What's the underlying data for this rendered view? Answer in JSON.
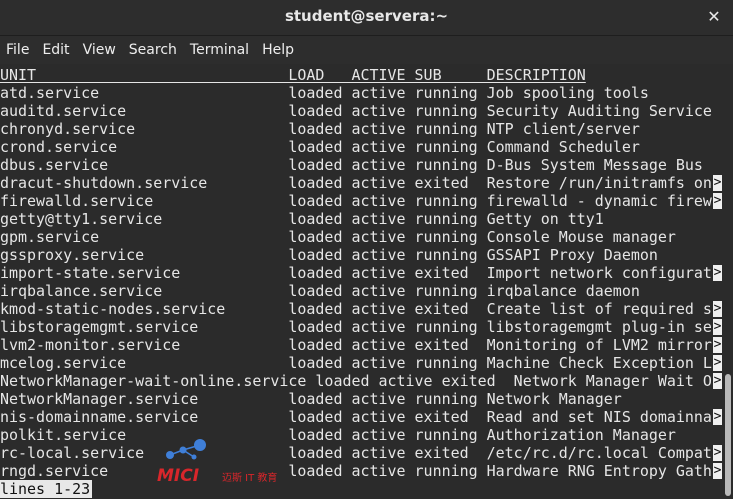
{
  "window": {
    "title": "student@servera:~",
    "close_glyph": "✕"
  },
  "menu": [
    "File",
    "Edit",
    "View",
    "Search",
    "Terminal",
    "Help"
  ],
  "terminal": {
    "header": "UNIT                            LOAD   ACTIVE SUB     DESCRIPTION",
    "rows": [
      {
        "text": "atd.service                     loaded active running Job spooling tools",
        "overflow": false
      },
      {
        "text": "auditd.service                  loaded active running Security Auditing Service",
        "overflow": false
      },
      {
        "text": "chronyd.service                 loaded active running NTP client/server",
        "overflow": false
      },
      {
        "text": "crond.service                   loaded active running Command Scheduler",
        "overflow": false
      },
      {
        "text": "dbus.service                    loaded active running D-Bus System Message Bus",
        "overflow": false
      },
      {
        "text": "dracut-shutdown.service         loaded active exited  Restore /run/initramfs on",
        "overflow": true
      },
      {
        "text": "firewalld.service               loaded active running firewalld - dynamic firew",
        "overflow": true
      },
      {
        "text": "getty@tty1.service              loaded active running Getty on tty1",
        "overflow": false
      },
      {
        "text": "gpm.service                     loaded active running Console Mouse manager",
        "overflow": false
      },
      {
        "text": "gssproxy.service                loaded active running GSSAPI Proxy Daemon",
        "overflow": false
      },
      {
        "text": "import-state.service            loaded active exited  Import network configurat",
        "overflow": true
      },
      {
        "text": "irqbalance.service              loaded active running irqbalance daemon",
        "overflow": false
      },
      {
        "text": "kmod-static-nodes.service       loaded active exited  Create list of required s",
        "overflow": true
      },
      {
        "text": "libstoragemgmt.service          loaded active running libstoragemgmt plug-in se",
        "overflow": true
      },
      {
        "text": "lvm2-monitor.service            loaded active exited  Monitoring of LVM2 mirror",
        "overflow": true
      },
      {
        "text": "mcelog.service                  loaded active running Machine Check Exception L",
        "overflow": true
      },
      {
        "text": "NetworkManager-wait-online.service loaded active exited  Network Manager Wait O",
        "overflow": true
      },
      {
        "text": "NetworkManager.service          loaded active running Network Manager",
        "overflow": false
      },
      {
        "text": "nis-domainname.service          loaded active exited  Read and set NIS domainna",
        "overflow": true
      },
      {
        "text": "polkit.service                  loaded active running Authorization Manager",
        "overflow": false
      },
      {
        "text": "rc-local.service                loaded active exited  /etc/rc.d/rc.local Compat",
        "overflow": true
      },
      {
        "text": "rngd.service                    loaded active running Hardware RNG Entropy Gath",
        "overflow": true
      }
    ],
    "overflow_marker": ">",
    "status": "lines 1-23"
  },
  "watermark": {
    "logo_text": "MICI",
    "subtitle": "迈斯 IT 教育",
    "color": "#d9262b"
  }
}
